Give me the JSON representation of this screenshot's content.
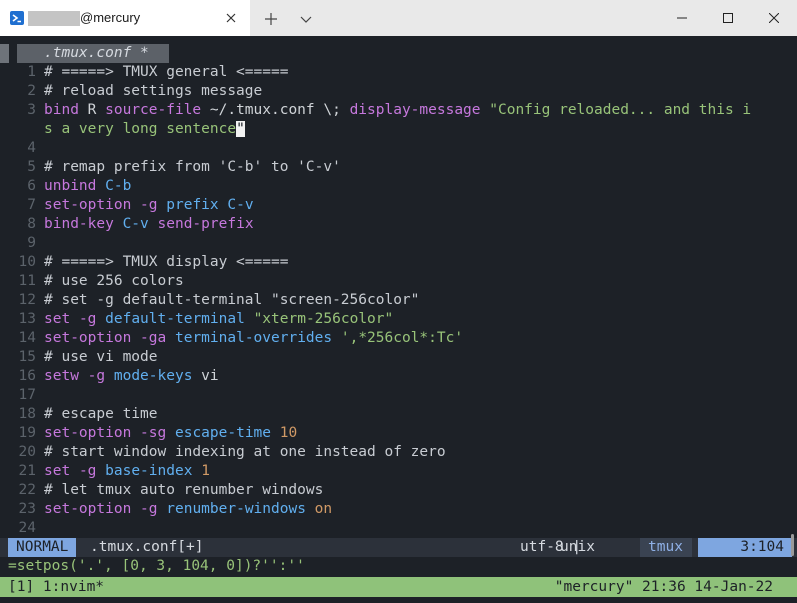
{
  "window": {
    "tab_title": "@mercury"
  },
  "editor": {
    "buffer_tab": ".tmux.conf *",
    "lines": [
      {
        "n": "1",
        "t": [
          [
            "cm",
            "# =====> TMUX general <====="
          ]
        ]
      },
      {
        "n": "2",
        "t": [
          [
            "cm",
            "# reload settings message"
          ]
        ]
      },
      {
        "n": "3",
        "t": [
          [
            "kw",
            "bind"
          ],
          [
            "tx",
            " R "
          ],
          [
            "kw",
            "source-file"
          ],
          [
            "tx",
            " ~/.tmux.conf \\; "
          ],
          [
            "kw",
            "display-message"
          ],
          [
            "tx",
            " "
          ],
          [
            "st",
            "\"Config reloaded... and this i"
          ]
        ]
      },
      {
        "n": "",
        "t": [
          [
            "st",
            "s a very long sentence"
          ],
          [
            "cursor",
            "\""
          ]
        ]
      },
      {
        "n": "4",
        "t": []
      },
      {
        "n": "5",
        "t": [
          [
            "cm",
            "# remap prefix from 'C-b' to 'C-v'"
          ]
        ]
      },
      {
        "n": "6",
        "t": [
          [
            "kw",
            "unbind"
          ],
          [
            "tx",
            " "
          ],
          [
            "fn",
            "C-b"
          ]
        ]
      },
      {
        "n": "7",
        "t": [
          [
            "kw",
            "set-option"
          ],
          [
            "tx",
            " "
          ],
          [
            "kw",
            "-g"
          ],
          [
            "tx",
            " "
          ],
          [
            "fn",
            "prefix"
          ],
          [
            "tx",
            " "
          ],
          [
            "fn",
            "C-v"
          ]
        ]
      },
      {
        "n": "8",
        "t": [
          [
            "kw",
            "bind-key"
          ],
          [
            "tx",
            " "
          ],
          [
            "fn",
            "C-v"
          ],
          [
            "tx",
            " "
          ],
          [
            "kw",
            "send-prefix"
          ]
        ]
      },
      {
        "n": "9",
        "t": []
      },
      {
        "n": "10",
        "t": [
          [
            "cm",
            "# =====> TMUX display <====="
          ]
        ]
      },
      {
        "n": "11",
        "t": [
          [
            "cm",
            "# use 256 colors"
          ]
        ]
      },
      {
        "n": "12",
        "t": [
          [
            "cm",
            "# set -g default-terminal \"screen-256color\""
          ]
        ]
      },
      {
        "n": "13",
        "t": [
          [
            "kw",
            "set"
          ],
          [
            "tx",
            " "
          ],
          [
            "kw",
            "-g"
          ],
          [
            "tx",
            " "
          ],
          [
            "fn",
            "default-terminal"
          ],
          [
            "tx",
            " "
          ],
          [
            "st",
            "\"xterm-256color\""
          ]
        ]
      },
      {
        "n": "14",
        "t": [
          [
            "kw",
            "set-option"
          ],
          [
            "tx",
            " "
          ],
          [
            "kw",
            "-ga"
          ],
          [
            "tx",
            " "
          ],
          [
            "fn",
            "terminal-overrides"
          ],
          [
            "tx",
            " "
          ],
          [
            "st",
            "',*256col*:Tc'"
          ]
        ]
      },
      {
        "n": "15",
        "t": [
          [
            "cm",
            "# use vi mode"
          ]
        ]
      },
      {
        "n": "16",
        "t": [
          [
            "kw",
            "setw"
          ],
          [
            "tx",
            " "
          ],
          [
            "kw",
            "-g"
          ],
          [
            "tx",
            " "
          ],
          [
            "fn",
            "mode-keys"
          ],
          [
            "tx",
            " vi"
          ]
        ]
      },
      {
        "n": "17",
        "t": []
      },
      {
        "n": "18",
        "t": [
          [
            "cm",
            "# escape time"
          ]
        ]
      },
      {
        "n": "19",
        "t": [
          [
            "kw",
            "set-option"
          ],
          [
            "tx",
            " "
          ],
          [
            "kw",
            "-sg"
          ],
          [
            "tx",
            " "
          ],
          [
            "fn",
            "escape-time"
          ],
          [
            "tx",
            " "
          ],
          [
            "nm",
            "10"
          ]
        ]
      },
      {
        "n": "20",
        "t": [
          [
            "cm",
            "# start window indexing at one instead of zero"
          ]
        ]
      },
      {
        "n": "21",
        "t": [
          [
            "kw",
            "set"
          ],
          [
            "tx",
            " "
          ],
          [
            "kw",
            "-g"
          ],
          [
            "tx",
            " "
          ],
          [
            "fn",
            "base-index"
          ],
          [
            "tx",
            " "
          ],
          [
            "nm",
            "1"
          ]
        ]
      },
      {
        "n": "22",
        "t": [
          [
            "cm",
            "# let tmux auto renumber windows"
          ]
        ]
      },
      {
        "n": "23",
        "t": [
          [
            "kw",
            "set-option"
          ],
          [
            "tx",
            " "
          ],
          [
            "kw",
            "-g"
          ],
          [
            "tx",
            " "
          ],
          [
            "fn",
            "renumber-windows"
          ],
          [
            "tx",
            " "
          ],
          [
            "nm",
            "on"
          ]
        ]
      },
      {
        "n": "24",
        "t": []
      }
    ]
  },
  "statusline": {
    "mode": "NORMAL",
    "file": ".tmux.conf[+]",
    "encoding": "utf-8 |",
    "format": "unix",
    "filetype": "tmux",
    "position": "3:104"
  },
  "cmdline": [
    [
      "st",
      "=setpos('.', [0, 3, 104, 0])?'':''"
    ]
  ],
  "tmux": {
    "left": "[1] 1:nvim*",
    "right": "\"mercury\" 21:36 14-Jan-22"
  },
  "colors": {
    "terminal_bg": "#1d2127",
    "tmux_bar": "#8fc27a",
    "mode_bg": "#7ea6e0",
    "keyword": "#c678dd",
    "function": "#61afef",
    "string": "#98c379",
    "number": "#d19a66"
  },
  "icons": {
    "tab": "powershell-icon",
    "close_tab": "close-icon",
    "new_tab": "plus-icon",
    "dropdown": "chevron-down-icon",
    "minimize": "minimize-icon",
    "maximize": "maximize-icon",
    "close": "close-icon"
  }
}
